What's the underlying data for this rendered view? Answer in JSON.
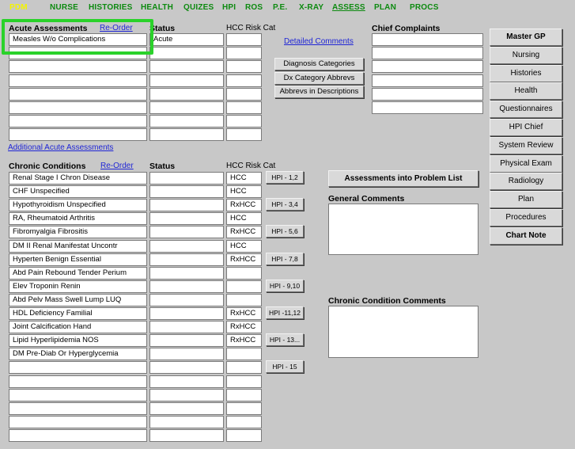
{
  "nav": {
    "items": [
      "PDM",
      "NURSE",
      "HISTORIES",
      "HEALTH",
      "QUIZES",
      "HPI",
      "ROS",
      "P.E.",
      "X-RAY",
      "ASSESS",
      "PLAN",
      "PROCS"
    ],
    "active_index": 0,
    "current_index": 9
  },
  "acute": {
    "header": "Acute Assessments",
    "reorder_label": "Re-Order",
    "status_header": "Status",
    "hcc_header": "HCC Risk Cat",
    "rows": [
      {
        "name": "Measles W/o Complications",
        "status": "Acute",
        "hcc": ""
      },
      {
        "name": "",
        "status": "",
        "hcc": ""
      },
      {
        "name": "",
        "status": "",
        "hcc": ""
      },
      {
        "name": "",
        "status": "",
        "hcc": ""
      },
      {
        "name": "",
        "status": "",
        "hcc": ""
      },
      {
        "name": "",
        "status": "",
        "hcc": ""
      },
      {
        "name": "",
        "status": "",
        "hcc": ""
      },
      {
        "name": "",
        "status": "",
        "hcc": ""
      }
    ],
    "additional_link": "Additional Acute Assessments"
  },
  "detailed_comments_link": "Detailed Comments",
  "category_buttons": [
    "Diagnosis Categories",
    "Dx Category Abbrevs",
    "Abbrevs in Descriptions"
  ],
  "chief_complaints": {
    "header": "Chief Complaints",
    "rows": [
      "",
      "",
      "",
      "",
      "",
      ""
    ]
  },
  "sidebar": {
    "items": [
      "Master GP",
      "Nursing",
      "Histories",
      "Health",
      "Questionnaires",
      "HPI Chief",
      "System Review",
      "Physical Exam",
      "Radiology",
      "Plan",
      "Procedures",
      "Chart Note"
    ]
  },
  "chronic": {
    "header": "Chronic Conditions",
    "reorder_label": "Re-Order",
    "status_header": "Status",
    "hcc_header": "HCC Risk Cat",
    "rows": [
      {
        "name": "Renal  Stage I Chron Disease",
        "status": "",
        "hcc": "HCC"
      },
      {
        "name": "CHF Unspecified",
        "status": "",
        "hcc": "HCC"
      },
      {
        "name": "Hypothyroidism Unspecified",
        "status": "",
        "hcc": "RxHCC"
      },
      {
        "name": "RA, Rheumatoid Arthritis",
        "status": "",
        "hcc": "HCC"
      },
      {
        "name": "Fibromyalgia Fibrositis",
        "status": "",
        "hcc": "RxHCC"
      },
      {
        "name": "DM  II Renal Manifestat Uncontr",
        "status": "",
        "hcc": "HCC"
      },
      {
        "name": "Hyperten  Benign Essential",
        "status": "",
        "hcc": "RxHCC"
      },
      {
        "name": "Abd Pain Rebound Tender Perium",
        "status": "",
        "hcc": ""
      },
      {
        "name": "Elev Troponin Renin",
        "status": "",
        "hcc": ""
      },
      {
        "name": "Abd Pelv Mass Swell Lump LUQ",
        "status": "",
        "hcc": ""
      },
      {
        "name": "HDL Deficiency Familial",
        "status": "",
        "hcc": "RxHCC"
      },
      {
        "name": "Joint Calcification Hand",
        "status": "",
        "hcc": "RxHCC"
      },
      {
        "name": "Lipid Hyperlipidemia NOS",
        "status": "",
        "hcc": "RxHCC"
      },
      {
        "name": "DM Pre-Diab Or Hyperglycemia",
        "status": "",
        "hcc": ""
      },
      {
        "name": "",
        "status": "",
        "hcc": ""
      },
      {
        "name": "",
        "status": "",
        "hcc": ""
      },
      {
        "name": "",
        "status": "",
        "hcc": ""
      },
      {
        "name": "",
        "status": "",
        "hcc": ""
      },
      {
        "name": "",
        "status": "",
        "hcc": ""
      },
      {
        "name": "",
        "status": "",
        "hcc": ""
      }
    ],
    "hpi_buttons": [
      {
        "label": "HPI - 1,2",
        "row": 0
      },
      {
        "label": "HPI - 3,4",
        "row": 2
      },
      {
        "label": "HPI - 5,6",
        "row": 4
      },
      {
        "label": "HPI - 7,8",
        "row": 6
      },
      {
        "label": "HPI - 9,10",
        "row": 8
      },
      {
        "label": "HPI -11,12",
        "row": 10
      },
      {
        "label": "HPI - 13...",
        "row": 12
      },
      {
        "label": "HPI - 15",
        "row": 14
      }
    ]
  },
  "problem_list_button": "Assessments into Problem List",
  "general_comments": {
    "header": "General Comments",
    "value": ""
  },
  "chronic_comments": {
    "header": "Chronic Condition Comments",
    "value": ""
  }
}
